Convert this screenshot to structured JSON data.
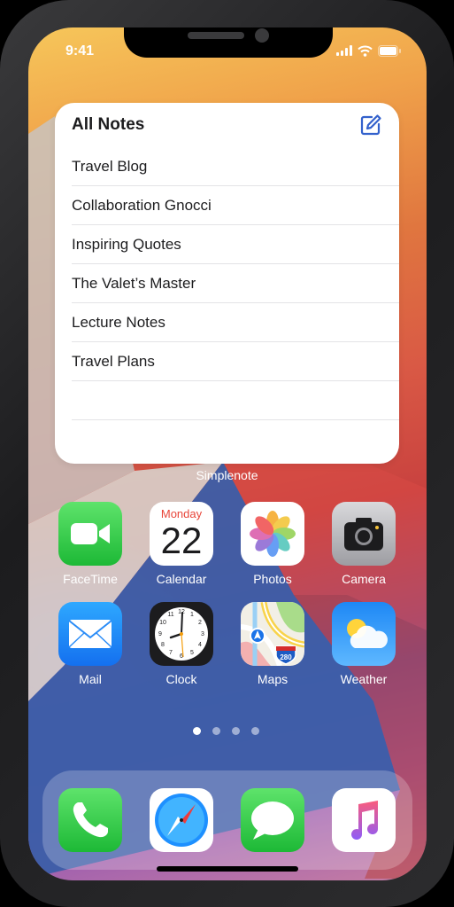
{
  "status_bar": {
    "time": "9:41"
  },
  "widget": {
    "title": "All Notes",
    "notes": [
      "Travel Blog",
      "Collaboration Gnocci",
      "Inspiring Quotes",
      "The Valet’s Master",
      "Lecture Notes",
      "Travel Plans",
      "",
      ""
    ],
    "label": "Simplenote",
    "accent": "#3361cc"
  },
  "apps": {
    "facetime": "FaceTime",
    "calendar": "Calendar",
    "calendar_day": "Monday",
    "calendar_date": "22",
    "photos": "Photos",
    "camera": "Camera",
    "mail": "Mail",
    "clock": "Clock",
    "maps": "Maps",
    "maps_shield": "280",
    "weather": "Weather"
  },
  "dock": [
    "phone-icon",
    "safari-icon",
    "messages-icon",
    "music-icon"
  ],
  "page_dots": {
    "count": 4,
    "active": 1
  }
}
